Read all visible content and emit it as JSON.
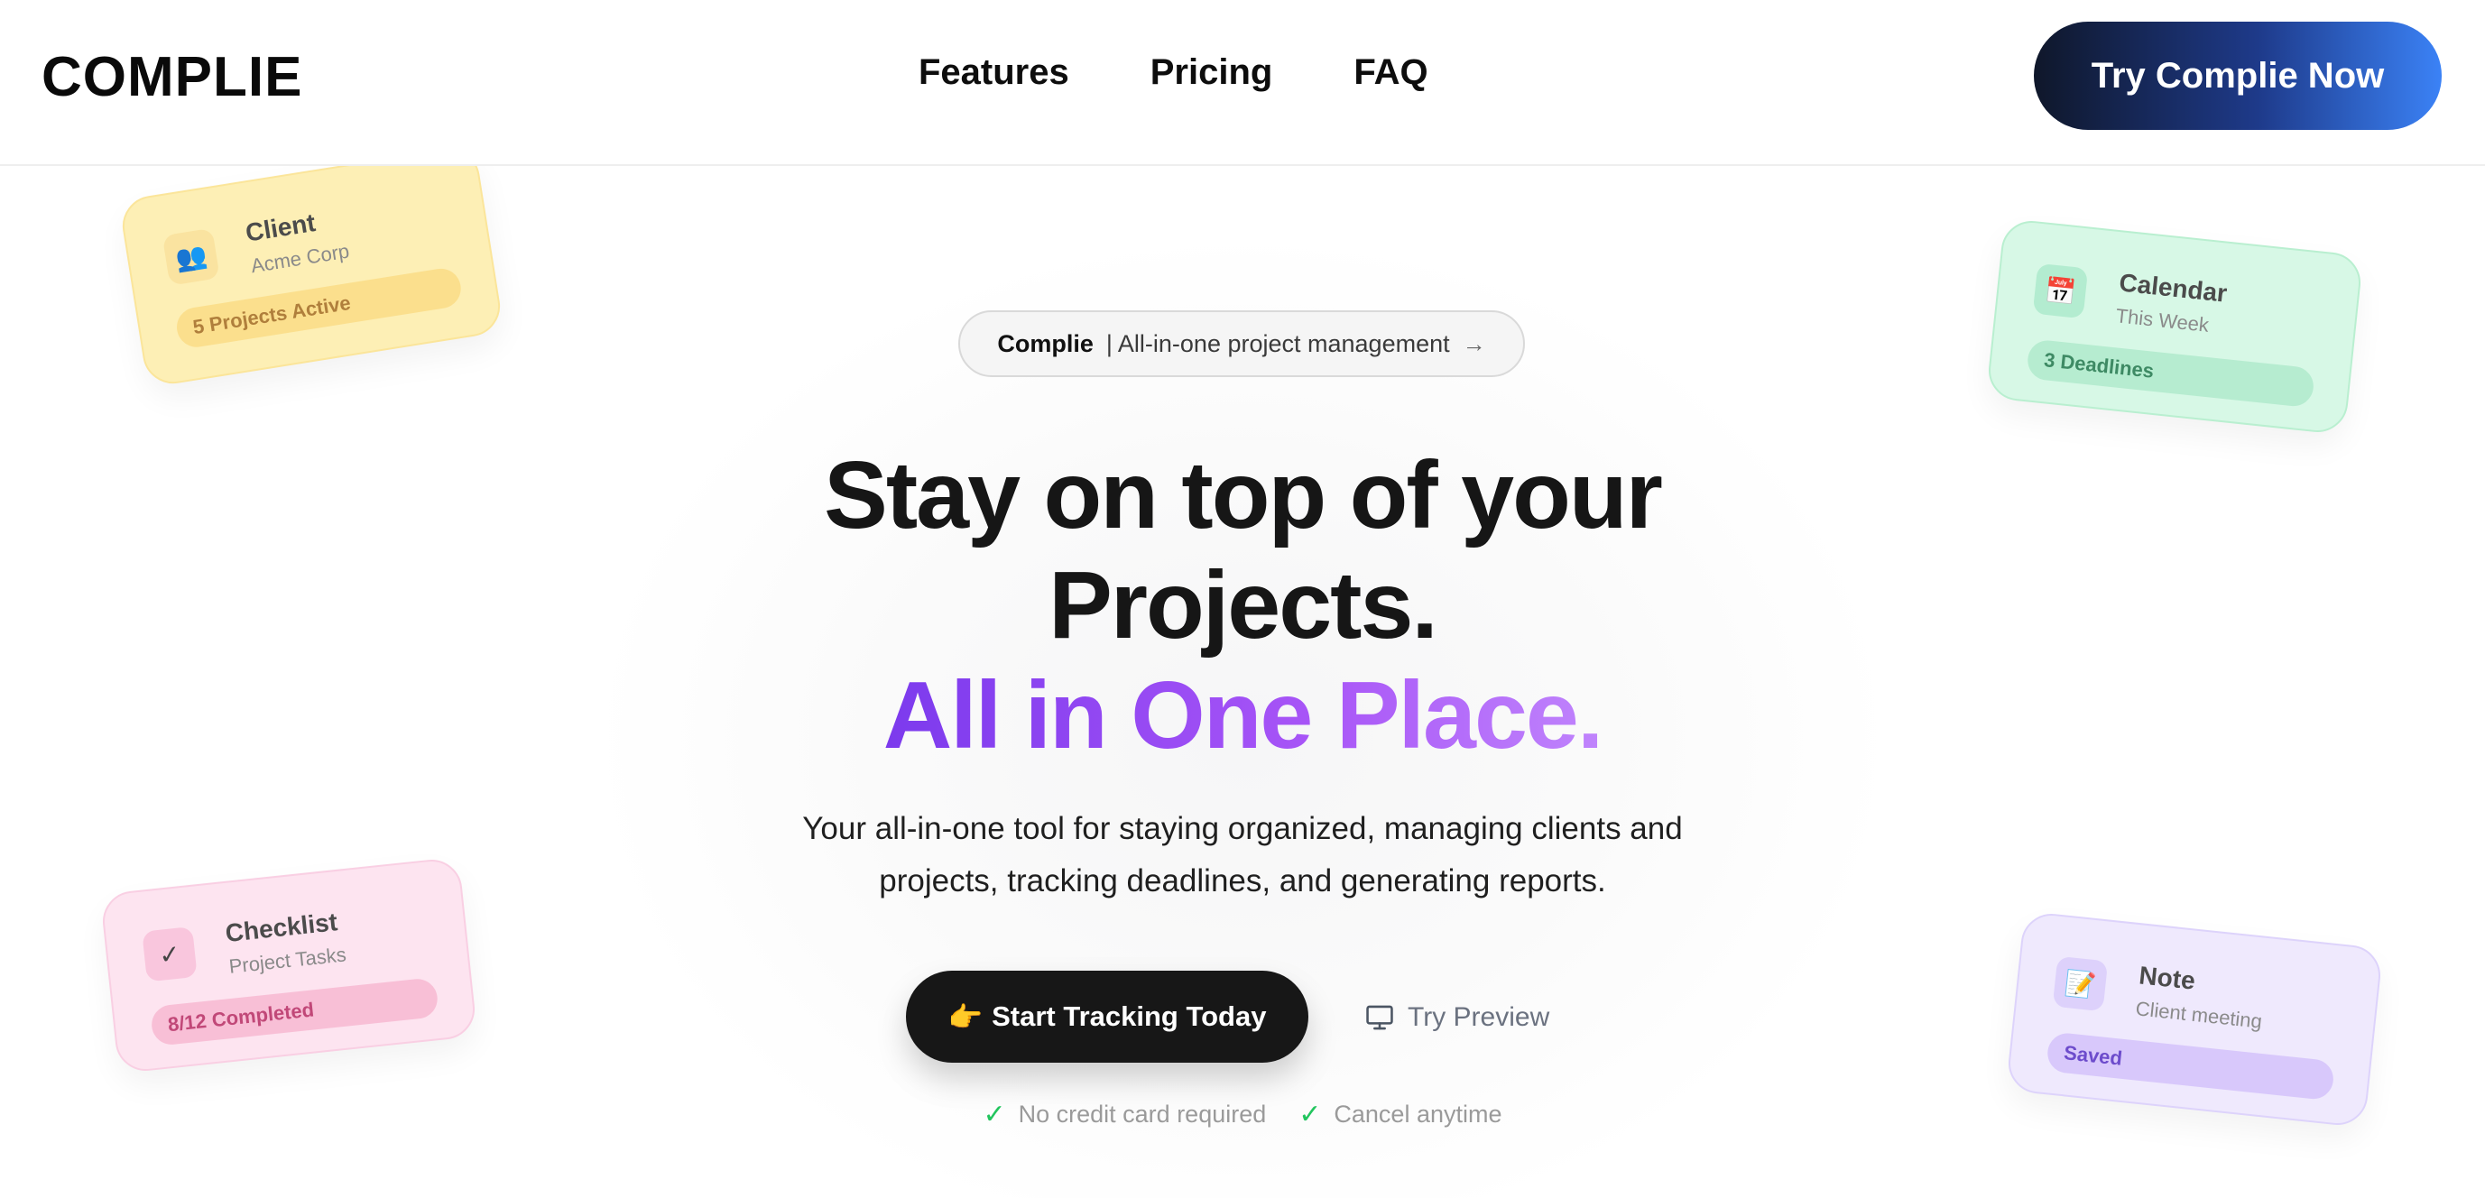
{
  "header": {
    "logo": "COMPLIE",
    "nav": [
      {
        "label": "Features"
      },
      {
        "label": "Pricing"
      },
      {
        "label": "FAQ"
      }
    ],
    "cta_label": "Try Complie Now"
  },
  "cards": {
    "client": {
      "icon": "users-icon",
      "title": "Client",
      "subtitle": "Acme Corp",
      "status": "5 Projects Active"
    },
    "calendar": {
      "icon": "calendar-icon",
      "title": "Calendar",
      "subtitle": "This Week",
      "status": "3 Deadlines"
    },
    "checklist": {
      "icon": "checkmark-icon",
      "title": "Checklist",
      "subtitle": "Project Tasks",
      "status": "8/12 Completed"
    },
    "note": {
      "icon": "memo-icon",
      "title": "Note",
      "subtitle": "Client meeting",
      "status": "Saved"
    }
  },
  "hero": {
    "badge": {
      "brand": "Complie",
      "text": "| All-in-one project management"
    },
    "headline_line1": "Stay on top of your",
    "headline_line2": "Projects.",
    "headline_accent": "All in One Place.",
    "description_line1": "Your all-in-one tool for staying organized, managing clients and",
    "description_line2": "projects, tracking deadlines, and generating reports.",
    "primary_button": {
      "emoji": "👉",
      "label": "Start Tracking Today"
    },
    "secondary_button": {
      "icon": "monitor-icon",
      "label": "Try Preview"
    },
    "features": [
      {
        "label": "No credit card required"
      },
      {
        "label": "Cancel anytime"
      }
    ]
  },
  "colors": {
    "accent_purple": "#8b5cf6",
    "cta_gradient_start": "#0f172a",
    "cta_gradient_end": "#3b82f6",
    "check_green": "#22c55e"
  }
}
